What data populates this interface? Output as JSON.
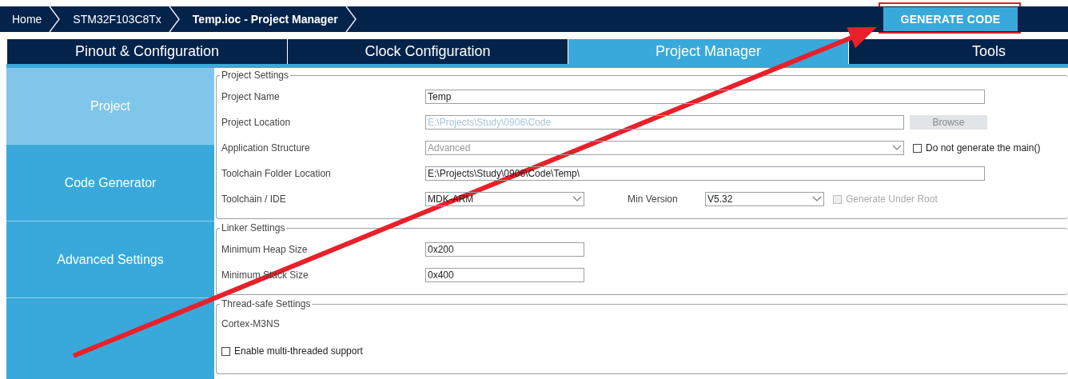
{
  "breadcrumbs": [
    {
      "label": "Home",
      "selected": false
    },
    {
      "label": "STM32F103C8Tx",
      "selected": false
    },
    {
      "label": "Temp.ioc - Project Manager",
      "selected": true
    }
  ],
  "generate_button": {
    "label": "GENERATE CODE",
    "highlighted": true
  },
  "tabs": [
    {
      "label": "Pinout & Configuration",
      "selected": false
    },
    {
      "label": "Clock Configuration",
      "selected": false
    },
    {
      "label": "Project Manager",
      "selected": true
    },
    {
      "label": "Tools",
      "selected": false
    }
  ],
  "sidebar": {
    "items": [
      {
        "label": "Project",
        "selected": true
      },
      {
        "label": "Code Generator",
        "selected": false
      },
      {
        "label": "Advanced Settings",
        "selected": false
      }
    ]
  },
  "sections": [
    {
      "title": "Project Settings",
      "rows": [
        {
          "kind": "field",
          "label": "Project Name",
          "controls": [
            {
              "kind": "text",
              "value": "Temp",
              "disabled": false
            }
          ]
        },
        {
          "kind": "field",
          "label": "Project Location",
          "controls": [
            {
              "kind": "text",
              "value": "E:\\Projects\\Study\\0906\\Code",
              "disabled": true
            },
            {
              "kind": "button",
              "label": "Browse",
              "disabled": true
            }
          ]
        },
        {
          "kind": "field",
          "label": "Application Structure",
          "controls": [
            {
              "kind": "select",
              "value": "Advanced",
              "disabled": true
            },
            {
              "kind": "checkbox",
              "label": "Do not generate the main()",
              "checked": false,
              "disabled": false
            }
          ]
        },
        {
          "kind": "field",
          "label": "Toolchain Folder Location",
          "controls": [
            {
              "kind": "text",
              "value": "E:\\Projects\\Study\\0906\\Code\\Temp\\",
              "disabled": false
            }
          ]
        },
        {
          "kind": "field",
          "label": "Toolchain / IDE",
          "controls": [
            {
              "kind": "select",
              "value": "MDK-ARM",
              "disabled": false
            },
            {
              "kind": "label",
              "label": "Min Version"
            },
            {
              "kind": "select",
              "value": "V5.32",
              "disabled": false
            },
            {
              "kind": "checkbox",
              "label": "Generate Under Root",
              "checked": false,
              "disabled": true
            }
          ]
        }
      ]
    },
    {
      "title": "Linker Settings",
      "rows": [
        {
          "kind": "field",
          "label": "Minimum Heap Size",
          "controls": [
            {
              "kind": "text",
              "value": "0x200",
              "disabled": false
            }
          ]
        },
        {
          "kind": "field",
          "label": "Minimum Stack Size",
          "controls": [
            {
              "kind": "text",
              "value": "0x400",
              "disabled": false
            }
          ]
        }
      ]
    },
    {
      "title": "Thread-safe Settings",
      "rows": [
        {
          "kind": "text",
          "text": "Cortex-M3NS"
        },
        {
          "kind": "checkbox",
          "label": "Enable multi-threaded support",
          "checked": false,
          "disabled": false
        }
      ]
    }
  ]
}
